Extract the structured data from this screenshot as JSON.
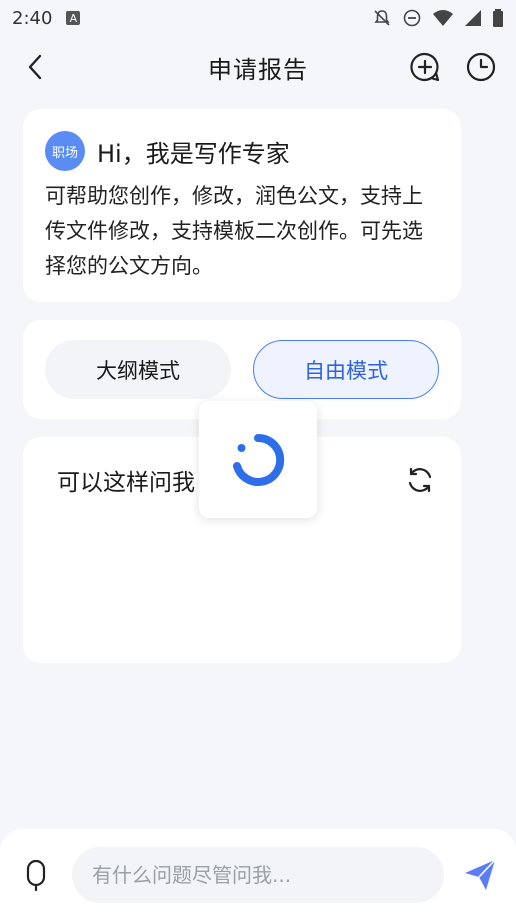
{
  "status": {
    "time": "2:40",
    "a_icon": "A"
  },
  "nav": {
    "title": "申请报告"
  },
  "intro": {
    "badge": "职场",
    "title": "Hi，我是写作专家",
    "body": "可帮助您创作，修改，润色公文，支持上传文件修改，支持模板二次创作。可先选择您的公文方向。"
  },
  "modes": {
    "outline": "大纲模式",
    "free": "自由模式",
    "selected": "自由模式"
  },
  "suggest": {
    "title": "可以这样问我"
  },
  "input": {
    "placeholder": "有什么问题尽管问我..."
  },
  "colors": {
    "accent": "#2f63e0",
    "badge": "#5a8cf3",
    "send": "#5b7cf5"
  }
}
